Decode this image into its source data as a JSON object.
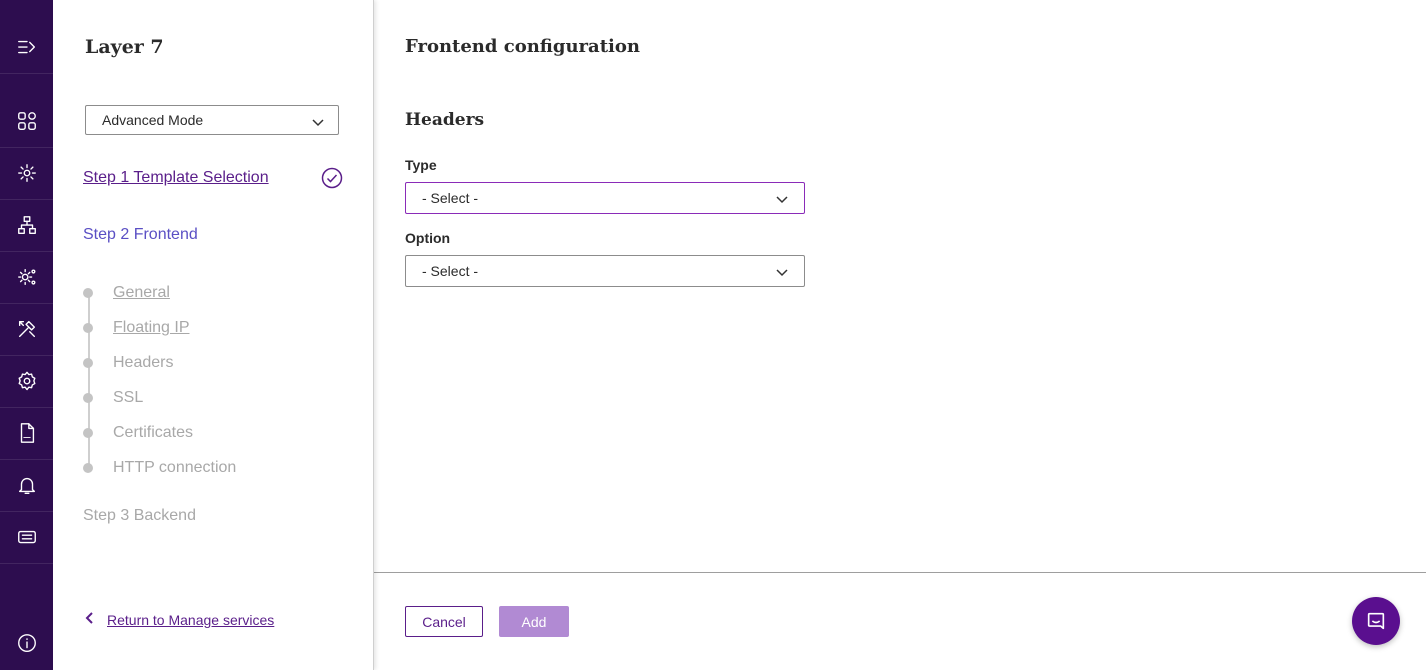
{
  "rail": {
    "icons": [
      "menu-expand-icon",
      "dashboard-icon",
      "services-icon",
      "network-icon",
      "settings-advanced-icon",
      "tools-icon",
      "gear-icon",
      "log-file-icon",
      "bell-icon",
      "ticket-icon",
      "info-icon"
    ]
  },
  "steps": {
    "title": "Layer 7",
    "mode": "Advanced Mode",
    "step1": "Step 1 Template Selection",
    "step2": "Step 2 Frontend",
    "substeps": [
      "General",
      "Floating IP",
      "Headers",
      "SSL",
      "Certificates",
      "HTTP connection"
    ],
    "step3": "Step 3 Backend",
    "return": "Return to Manage services"
  },
  "main": {
    "title": "Frontend configuration",
    "section": "Headers",
    "type_label": "Type",
    "type_value": "- Select -",
    "option_label": "Option",
    "option_value": "- Select -"
  },
  "footer": {
    "cancel": "Cancel",
    "add": "Add"
  },
  "colors": {
    "rail": "#2d0d4f",
    "accent": "#5a1e8a",
    "step2": "#5a4fc4",
    "add_button": "#b18ad3"
  }
}
